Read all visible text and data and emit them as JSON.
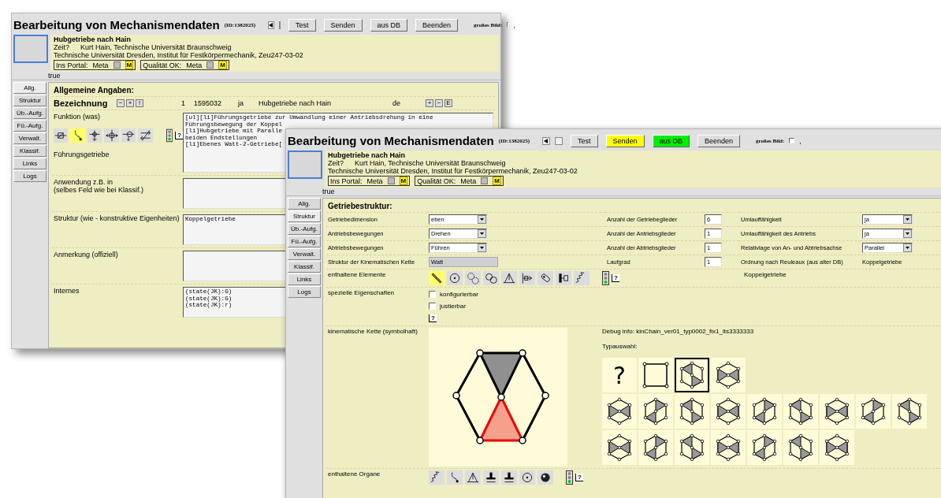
{
  "back_window": {
    "title": "Bearbeitung von Mechanismendaten",
    "id_label": "(ID:1382025)",
    "buttons": [
      {
        "label": "Test",
        "color": "#dedede"
      },
      {
        "label": "Senden",
        "color": "#dedede"
      },
      {
        "label": "aus DB",
        "color": "#dedede"
      },
      {
        "label": "Beenden",
        "color": "#dedede"
      }
    ],
    "big_picture": {
      "label": "großes Bild:",
      "checked": false,
      "suffix": ","
    },
    "record": {
      "name": "Hubgetriebe nach Hain",
      "time_label": "Zeit?",
      "author": "Kurt Hain, Technische Universität Braunschweig",
      "source": "Technische Universität Dresden, Institut für Festkörpermechanik, Zeu247-03-02",
      "flags": [
        {
          "label": "Ins Portal:",
          "value": "Meta",
          "checked": true,
          "badge": "M"
        },
        {
          "label": "Qualität OK:",
          "value": "Meta",
          "checked": true,
          "badge": "M"
        }
      ]
    },
    "status": "true",
    "tabs": [
      {
        "label": "Allg.",
        "selected": true
      },
      {
        "label": "Struktur",
        "selected": false
      },
      {
        "label": "Üb.-Aufg.",
        "selected": false
      },
      {
        "label": "Fü.-Aufg.",
        "selected": false
      },
      {
        "label": "Verwalt.",
        "selected": false
      },
      {
        "label": "Klassif.",
        "selected": false
      },
      {
        "label": "Links",
        "selected": false
      },
      {
        "label": "Logs",
        "selected": false
      }
    ],
    "section_title": "Allgemeine Angaben:",
    "designation": {
      "label": "Bezeichnung",
      "tools": [
        "−",
        "+",
        "!"
      ],
      "cells": [
        "1",
        "1595032",
        "ja",
        "Hubgetriebe nach Hain",
        "de"
      ],
      "actions": [
        "+",
        "−",
        "E"
      ]
    },
    "function": {
      "label": "Funktion (was)",
      "caption": "Führungsgetriebe",
      "help": "?",
      "icons": [
        {
          "kind": "box-arrow",
          "selected": false
        },
        {
          "kind": "curve",
          "selected": true
        },
        {
          "kind": "cross-down",
          "selected": false
        },
        {
          "kind": "cross-circle",
          "selected": false
        },
        {
          "kind": "circle-arrow",
          "selected": false
        },
        {
          "kind": "crossed-arrows",
          "selected": false
        }
      ],
      "text_lines": [
        "[ul][li]Führungsgetriebe zur Umwandlung einer Antriebsdrehung in eine",
        "Führungsbewegung der Koppel",
        "[li]Hubgetriebe mit Paralle",
        "beiden Endstellungen",
        "[li]Ebenes Watt-2-Getriebe["
      ]
    },
    "fields": [
      {
        "label_lines": [
          "Anwendung z.B. in",
          "(selbes Feld wie bei Klassif.)"
        ]
      },
      {
        "label_lines": [
          "Struktur (wie - konstruktive Eigenheiten)"
        ],
        "lines": [
          "Koppelgetriebe"
        ]
      },
      {
        "label_lines": [
          "Anmerkung (offiziell)"
        ]
      },
      {
        "label_lines": [
          "Internes"
        ],
        "lines": [
          "(state(JK):G)",
          "(state(JK):G)",
          "(state(JK):r)"
        ]
      }
    ]
  },
  "front_window": {
    "title": "Bearbeitung von Mechanismendaten",
    "id_label": "(ID:1382025)",
    "buttons": [
      {
        "label": "Test",
        "color": "#dedede"
      },
      {
        "label": "Senden",
        "color": "#ffff00"
      },
      {
        "label": "aus DB",
        "color": "#00ee00"
      },
      {
        "label": "Beenden",
        "color": "#dedede"
      }
    ],
    "big_picture": {
      "label": "großes Bild:",
      "checked": false,
      "suffix": ","
    },
    "record": {
      "name": "Hubgetriebe nach Hain",
      "time_label": "Zeit?",
      "author": "Kurt Hain, Technische Universität Braunschweig",
      "source": "Technische Universität Dresden, Institut für Festkörpermechanik, Zeu247-03-02",
      "flags": [
        {
          "label": "Ins Portal:",
          "value": "Meta",
          "checked": true,
          "badge": "M"
        },
        {
          "label": "Qualität OK:",
          "value": "Meta",
          "checked": true,
          "badge": "M"
        }
      ]
    },
    "status": "true",
    "tabs": [
      {
        "label": "Allg.",
        "selected": false
      },
      {
        "label": "Struktur",
        "selected": true
      },
      {
        "label": "Üb.-Aufg.",
        "selected": false
      },
      {
        "label": "Fü.-Aufg.",
        "selected": false
      },
      {
        "label": "Verwalt.",
        "selected": false
      },
      {
        "label": "Klassif.",
        "selected": false
      },
      {
        "label": "Links",
        "selected": false
      },
      {
        "label": "Logs",
        "selected": false
      }
    ],
    "section_title": "Getriebestruktur:",
    "grid": [
      [
        {
          "label": "Getriebedimension",
          "kind": "select",
          "value": "eben"
        },
        {
          "label": "Anzahl der Getriebeglieder",
          "kind": "input",
          "value": "6"
        },
        {
          "label": "Umlauffähigkeit",
          "kind": "select",
          "value": "ja"
        }
      ],
      [
        {
          "label": "Antriebsbewegungen",
          "kind": "select",
          "value": "Drehen"
        },
        {
          "label": "Anzahl der Antriebsglieder",
          "kind": "input",
          "value": "1"
        },
        {
          "label": "Umlauffähigkeit des Antriebs",
          "kind": "select",
          "value": "ja"
        }
      ],
      [
        {
          "label": "Abtriebsbewegungen",
          "kind": "select",
          "value": "Führen"
        },
        {
          "label": "Anzahl der Abtriebsglieder",
          "kind": "input",
          "value": "1"
        },
        {
          "label": "Relativlage von An- und Abtriebsachse",
          "kind": "select",
          "value": "Parallel"
        }
      ],
      [
        {
          "label": "Struktur der Kinematischen Kette",
          "kind": "readonly",
          "value": "Watt"
        },
        {
          "label": "Laufgrad",
          "kind": "input",
          "value": "1"
        },
        {
          "label": "Ordnung nach Reuleaux (aus alter DB)",
          "kind": "text",
          "value": "Koppelgetriebe"
        }
      ]
    ],
    "elements": {
      "label": "enthaltene Elemente",
      "help": "?",
      "note": "Koppelgetriebe",
      "icons": [
        {
          "kind": "bar",
          "selected": true
        },
        {
          "kind": "disc",
          "selected": false
        },
        {
          "kind": "gears",
          "selected": false
        },
        {
          "kind": "wheels",
          "selected": false
        },
        {
          "kind": "lever",
          "selected": false
        },
        {
          "kind": "slider",
          "selected": false
        },
        {
          "kind": "roller",
          "selected": false
        },
        {
          "kind": "clamp",
          "selected": false
        },
        {
          "kind": "spring",
          "selected": false
        }
      ]
    },
    "properties": {
      "label": "spezielle Eigenschaften",
      "help": "?",
      "options": [
        {
          "label": "konfigurierbar",
          "checked": false
        },
        {
          "label": "justierbar",
          "checked": false
        }
      ]
    },
    "chain": {
      "label": "kinematische Kette (symbolhaft)",
      "debug": "Debug info: kinChain_ver01_typ0002_fix1_lts3333333",
      "type_label": "Typauswahl:",
      "tile_rows": [
        [
          {
            "kind": "unknown",
            "label": "?",
            "selected": false
          },
          {
            "kind": "square",
            "selected": false
          },
          {
            "kind": "graph",
            "selected": true
          },
          {
            "kind": "graph",
            "selected": false
          }
        ],
        [
          {
            "kind": "graph",
            "selected": false
          },
          {
            "kind": "graph",
            "selected": false
          },
          {
            "kind": "graph",
            "selected": false
          },
          {
            "kind": "graph",
            "selected": false
          },
          {
            "kind": "graph",
            "selected": false
          },
          {
            "kind": "graph",
            "selected": false
          },
          {
            "kind": "graph",
            "selected": false
          },
          {
            "kind": "graph",
            "selected": false
          },
          {
            "kind": "graph",
            "selected": false
          }
        ],
        [
          {
            "kind": "graph",
            "selected": false
          },
          {
            "kind": "graph",
            "selected": false
          },
          {
            "kind": "graph",
            "selected": false
          },
          {
            "kind": "graph",
            "selected": false
          },
          {
            "kind": "graph",
            "selected": false
          },
          {
            "kind": "graph",
            "selected": false
          },
          {
            "kind": "graph",
            "selected": false
          }
        ]
      ]
    },
    "organs": {
      "label": "enthaltene Organe",
      "help": "?",
      "icons": [
        {
          "kind": "spring",
          "selected": false
        },
        {
          "kind": "curve",
          "selected": false
        },
        {
          "kind": "lever",
          "selected": false
        },
        {
          "kind": "press",
          "selected": false
        },
        {
          "kind": "press",
          "selected": false
        },
        {
          "kind": "disc",
          "selected": false
        },
        {
          "kind": "cog",
          "selected": false
        }
      ]
    }
  }
}
